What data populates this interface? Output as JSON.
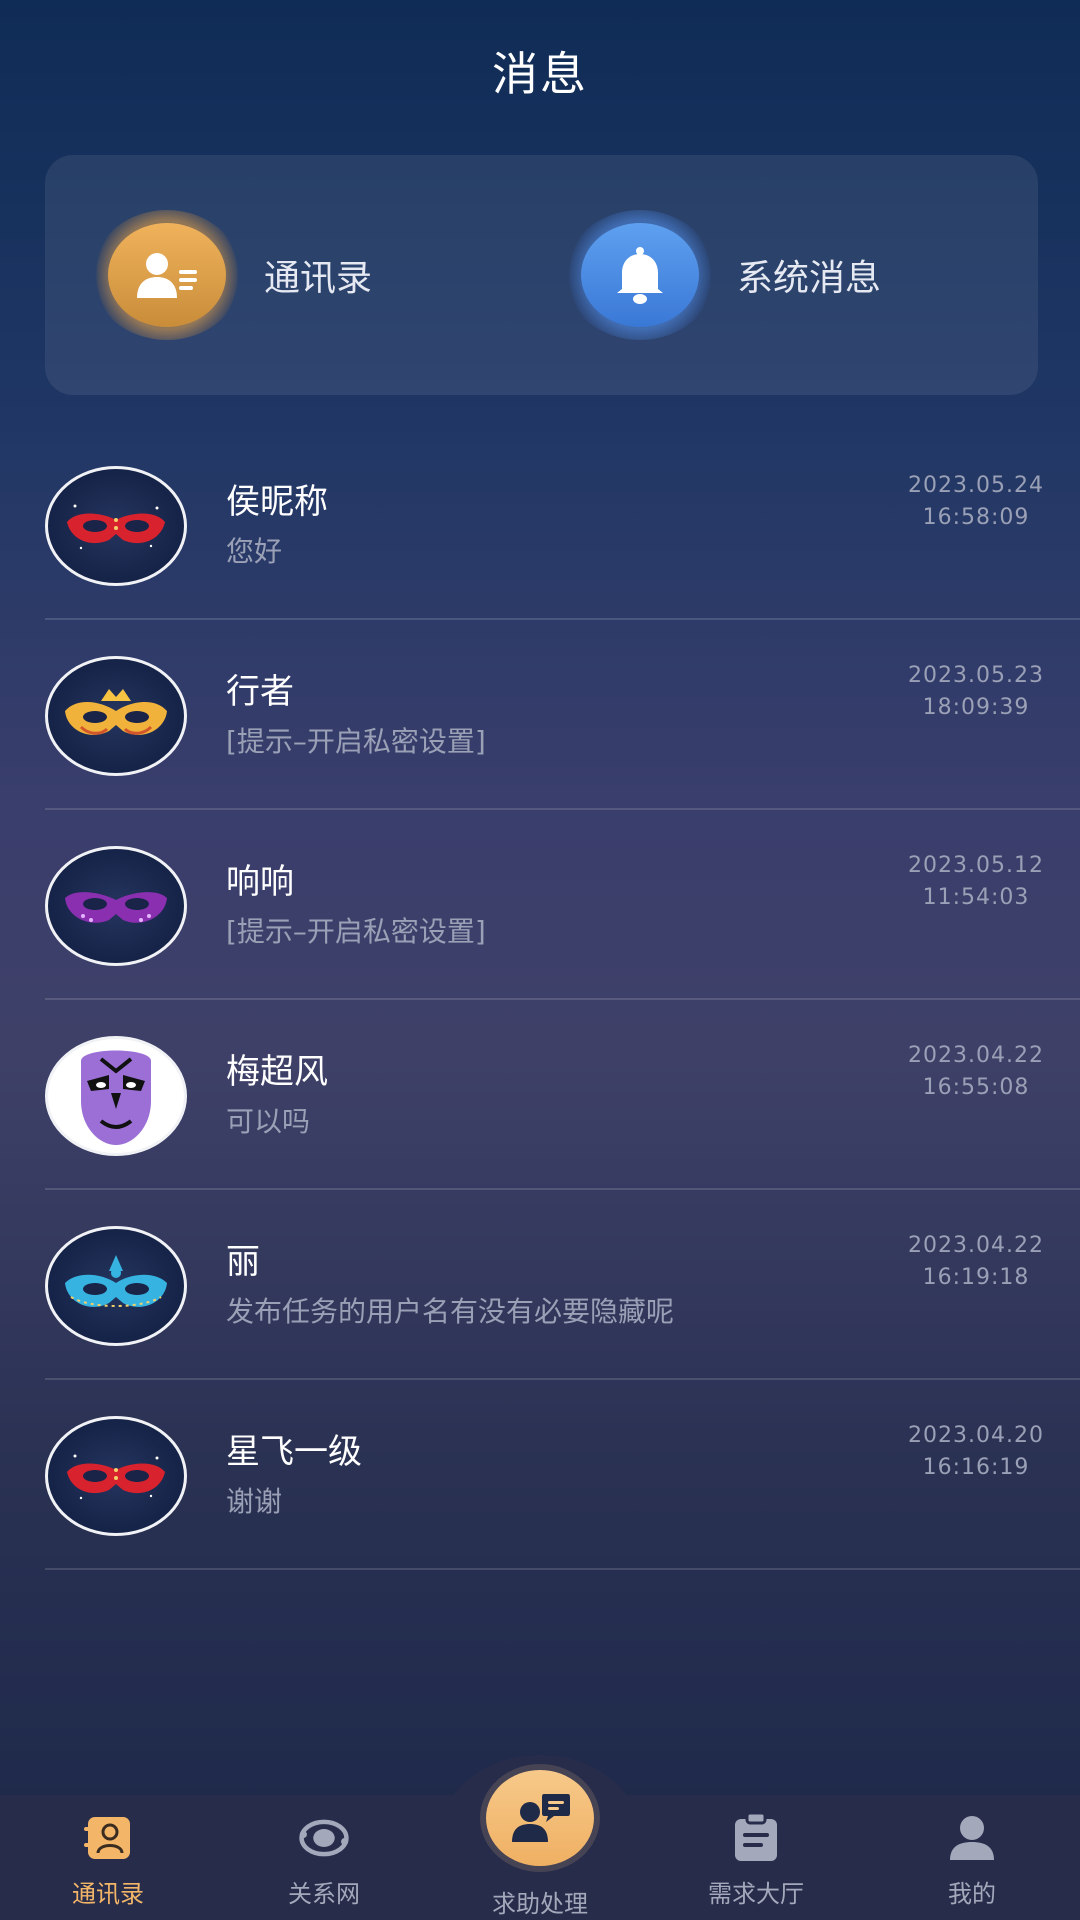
{
  "header": {
    "title": "消息"
  },
  "quick": {
    "contacts_label": "通讯录",
    "system_label": "系统消息"
  },
  "conversations": [
    {
      "name": "侯昵称",
      "preview": "您好",
      "date": "2023.05.24",
      "time": "16:58:09",
      "avatar": "red-mask",
      "avatar_color": "#d8232f"
    },
    {
      "name": "行者",
      "preview": "[提示–开启私密设置]",
      "date": "2023.05.23",
      "time": "18:09:39",
      "avatar": "gold-mask",
      "avatar_color": "#f0b23a"
    },
    {
      "name": "响响",
      "preview": "[提示–开启私密设置]",
      "date": "2023.05.12",
      "time": "11:54:03",
      "avatar": "purple-mask",
      "avatar_color": "#8a2fb0"
    },
    {
      "name": "梅超风",
      "preview": "可以吗",
      "date": "2023.04.22",
      "time": "16:55:08",
      "avatar": "opera-face",
      "avatar_color": "#9b6fd6"
    },
    {
      "name": "丽",
      "preview": "发布任务的用户名有没有必要隐藏呢",
      "date": "2023.04.22",
      "time": "16:19:18",
      "avatar": "blue-mask",
      "avatar_color": "#36b3e0"
    },
    {
      "name": "星飞一级",
      "preview": "谢谢",
      "date": "2023.04.20",
      "time": "16:16:19",
      "avatar": "red-mask",
      "avatar_color": "#d8232f"
    }
  ],
  "tabbar": {
    "tabs": [
      {
        "label": "通讯录",
        "icon": "contacts-icon",
        "active": true
      },
      {
        "label": "关系网",
        "icon": "network-icon",
        "active": false
      },
      {
        "label": "求助处理",
        "icon": "help-chat-icon",
        "active": false
      },
      {
        "label": "需求大厅",
        "icon": "clipboard-icon",
        "active": false
      },
      {
        "label": "我的",
        "icon": "profile-icon",
        "active": false
      }
    ]
  },
  "colors": {
    "accent": "#f3b668",
    "contacts_icon_bg": "#e0a34e",
    "bell_icon_bg": "#4c8ee6",
    "muted_text": "#9aa0b5"
  }
}
